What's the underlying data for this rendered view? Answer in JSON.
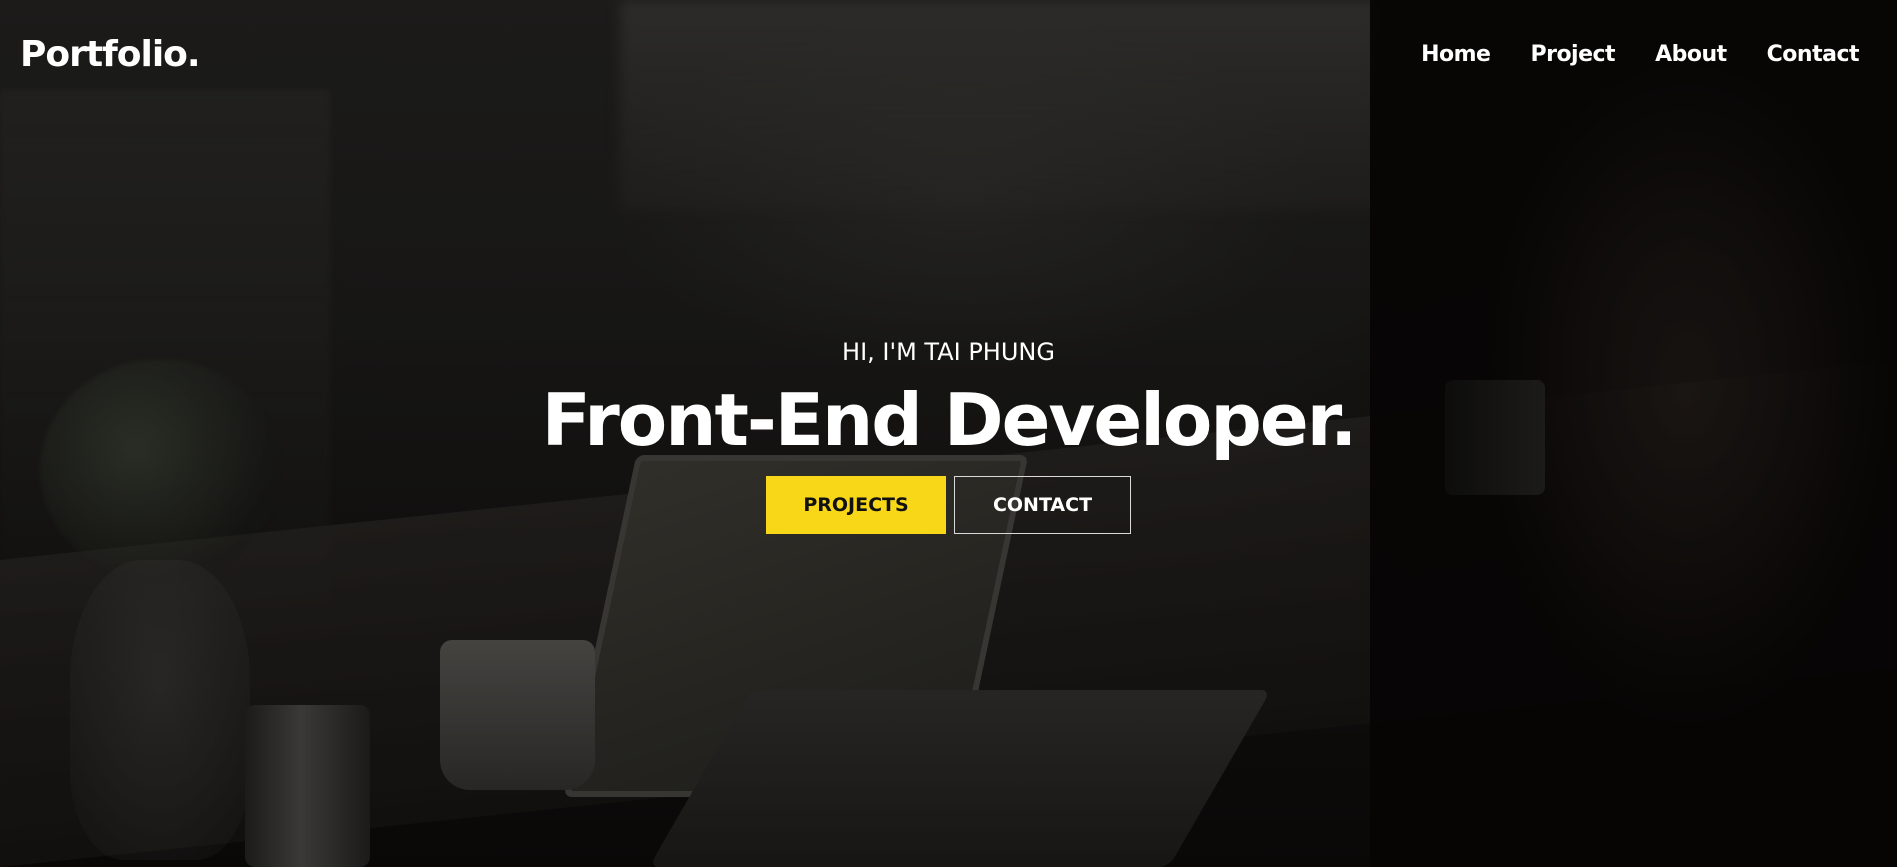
{
  "header": {
    "logo": "Portfolio.",
    "nav": [
      {
        "label": "Home"
      },
      {
        "label": "Project"
      },
      {
        "label": "About"
      },
      {
        "label": "Contact"
      }
    ]
  },
  "hero": {
    "greeting": "HI, I'M TAI PHUNG",
    "headline": "Front-End Developer.",
    "buttons": {
      "primary": "PROJECTS",
      "secondary": "CONTACT"
    }
  },
  "colors": {
    "accent": "#f7d717",
    "text": "#ffffff",
    "background": "#1c1a18"
  }
}
